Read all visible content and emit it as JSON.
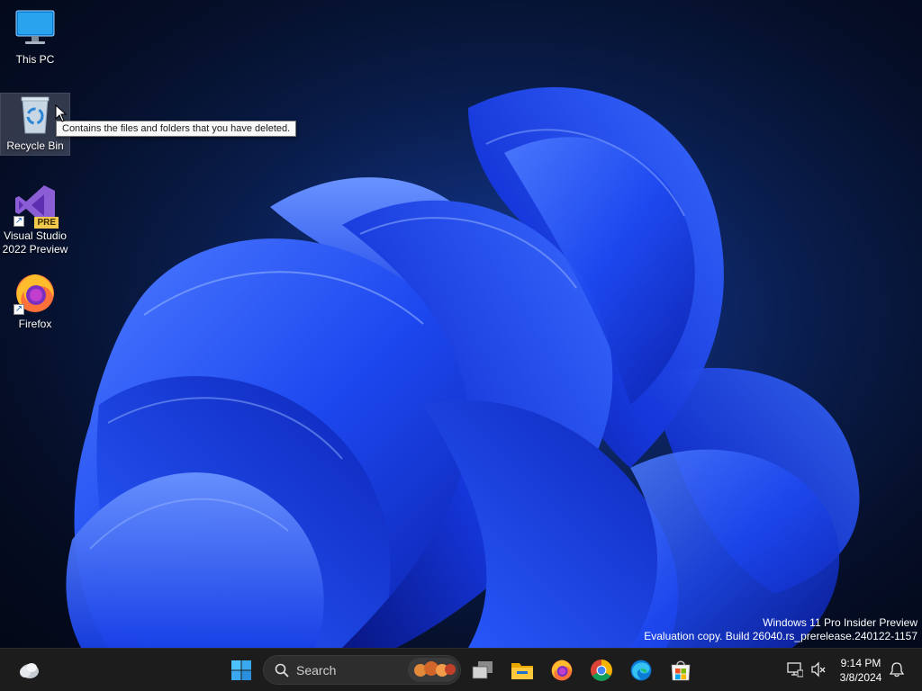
{
  "desktop": {
    "icons": [
      {
        "label": "This PC",
        "icon": "monitor-icon"
      },
      {
        "label": "Recycle Bin",
        "icon": "recycle-bin-icon"
      },
      {
        "label": "Visual Studio 2022 Preview",
        "badge": "PRE",
        "icon": "visual-studio-icon"
      },
      {
        "label": "Firefox",
        "icon": "firefox-icon"
      }
    ],
    "tooltip": "Contains the files and folders that you have deleted.",
    "watermark": {
      "line1": "Windows 11 Pro Insider Preview",
      "line2": "Evaluation copy. Build 26040.rs_prerelease.240122-1157"
    }
  },
  "taskbar": {
    "search_placeholder": "Search",
    "apps": [
      "widgets-icon",
      "start-icon",
      "task-view-icon",
      "file-explorer-icon",
      "firefox-icon",
      "chrome-icon",
      "edge-icon",
      "store-icon"
    ],
    "clock": {
      "time": "9:14 PM",
      "date": "3/8/2024"
    }
  },
  "colors": {
    "accent": "#0078d4",
    "taskbar_bg": "#1c1c1c",
    "wallpaper_blue": "#1f4dff"
  }
}
